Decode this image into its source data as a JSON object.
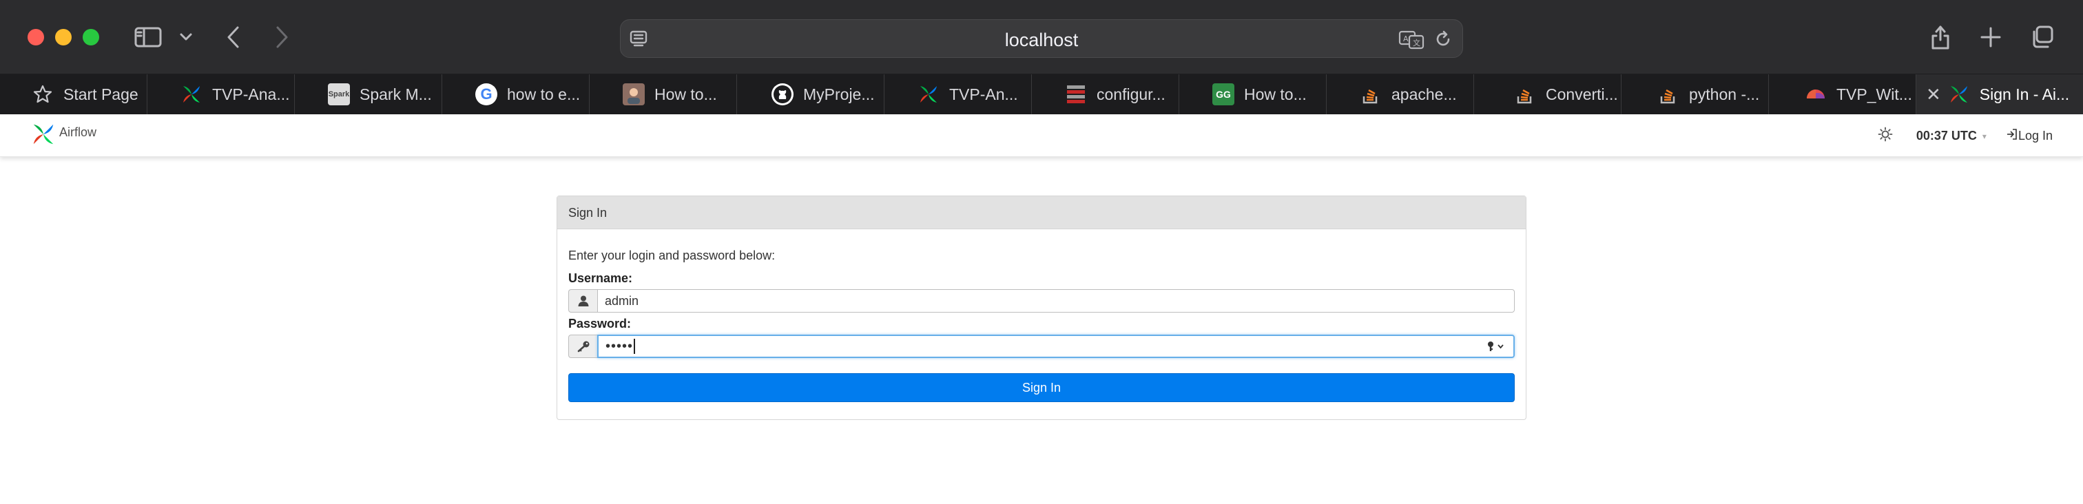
{
  "browser": {
    "address": "localhost",
    "tabs": [
      {
        "label": "Start Page",
        "icon": "star-icon"
      },
      {
        "label": "TVP-Ana...",
        "icon": "airflow-logo-icon"
      },
      {
        "label": "Spark M...",
        "icon": "spark-logo-icon"
      },
      {
        "label": "how to e...",
        "icon": "google-logo-icon"
      },
      {
        "label": "How to...",
        "icon": "user-avatar-icon"
      },
      {
        "label": "MyProje...",
        "icon": "github-logo-icon"
      },
      {
        "label": "TVP-An...",
        "icon": "airflow-logo-icon"
      },
      {
        "label": "configur...",
        "icon": "bars-logo-icon"
      },
      {
        "label": "How to...",
        "icon": "geeksforgeeks-logo-icon"
      },
      {
        "label": "apache...",
        "icon": "stackoverflow-logo-icon"
      },
      {
        "label": "Converti...",
        "icon": "stackoverflow-logo-icon"
      },
      {
        "label": "python -...",
        "icon": "stackoverflow-logo-icon"
      },
      {
        "label": "TVP_Wit...",
        "icon": "colorful-logo-icon"
      },
      {
        "label": "Sign In - Ai...",
        "icon": "airflow-logo-icon",
        "active": true
      }
    ]
  },
  "navbar": {
    "brand": "Airflow",
    "time": "00:37 UTC",
    "login": "Log In"
  },
  "login": {
    "heading": "Sign In",
    "intro": "Enter your login and password below:",
    "username_label": "Username:",
    "username_value": "admin",
    "password_label": "Password:",
    "password_value": "•••••",
    "submit": "Sign In"
  },
  "colors": {
    "accent": "#017cee",
    "chrome_bg": "#2c2c2e",
    "tabbar_bg": "#1c1c1e"
  }
}
